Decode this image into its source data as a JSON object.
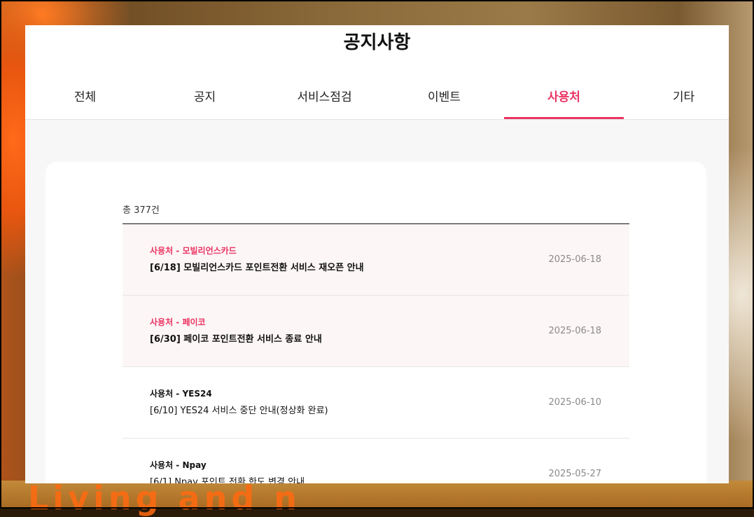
{
  "page": {
    "title": "공지사항"
  },
  "tabs": [
    {
      "label": "전체",
      "active": false
    },
    {
      "label": "공지",
      "active": false
    },
    {
      "label": "서비스점검",
      "active": false
    },
    {
      "label": "이벤트",
      "active": false
    },
    {
      "label": "사용처",
      "active": true
    },
    {
      "label": "기타",
      "active": false
    }
  ],
  "list": {
    "total_label": "총 377건",
    "items": [
      {
        "category": "사용처 - 모빌리언스카드",
        "title": "[6/18] 모빌리언스카드 포인트전환 서비스 재오픈 안내",
        "date": "2025-06-18",
        "highlight": true
      },
      {
        "category": "사용처 - 페이코",
        "title": "[6/30] 페이코 포인트전환 서비스 종료 안내",
        "date": "2025-06-18",
        "highlight": true
      },
      {
        "category": "사용처 - YES24",
        "title": "[6/10] YES24 서비스 중단 안내(정상화 완료)",
        "date": "2025-06-10",
        "highlight": false
      },
      {
        "category": "사용처 - Npay",
        "title": "[6/1] Npay 포인트 전환 한도 변경 안내",
        "date": "2025-05-27",
        "highlight": false
      }
    ]
  },
  "background": {
    "overlay_text": "Living and n"
  },
  "colors": {
    "accent": "#ea3463",
    "highlight_row": "#fdf6f6",
    "panel_bg": "#f7f7f7"
  }
}
